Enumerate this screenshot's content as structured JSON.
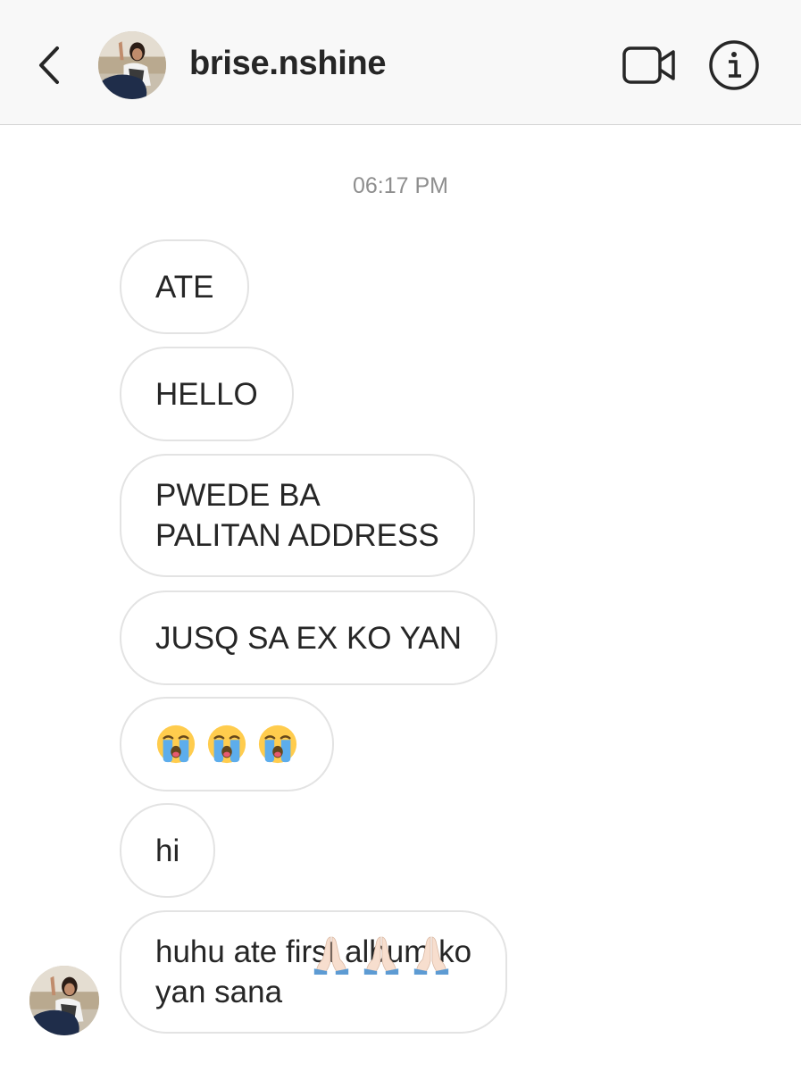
{
  "header": {
    "username": "brise.nshine",
    "back_icon": "chevron-left-icon",
    "video_icon": "video-camera-icon",
    "info_icon": "info-icon"
  },
  "thread": {
    "timestamp": "06:17 PM",
    "messages": [
      {
        "text": "ATE"
      },
      {
        "text": "HELLO"
      },
      {
        "text": "PWEDE BA\nPALITAN ADDRESS"
      },
      {
        "text": "JUSQ SA EX KO YAN"
      },
      {
        "text": "",
        "emoji": "loudly-crying-face",
        "emoji_count": 3
      },
      {
        "text": "hi"
      },
      {
        "text": "huhu ate first album ko\nyan sana",
        "emoji": "folded-hands",
        "emoji_count": 3
      }
    ]
  },
  "colors": {
    "header_bg": "#f8f8f8",
    "bubble_border": "#e3e3e3",
    "text": "#262626",
    "timestamp": "#8e8e8e"
  }
}
